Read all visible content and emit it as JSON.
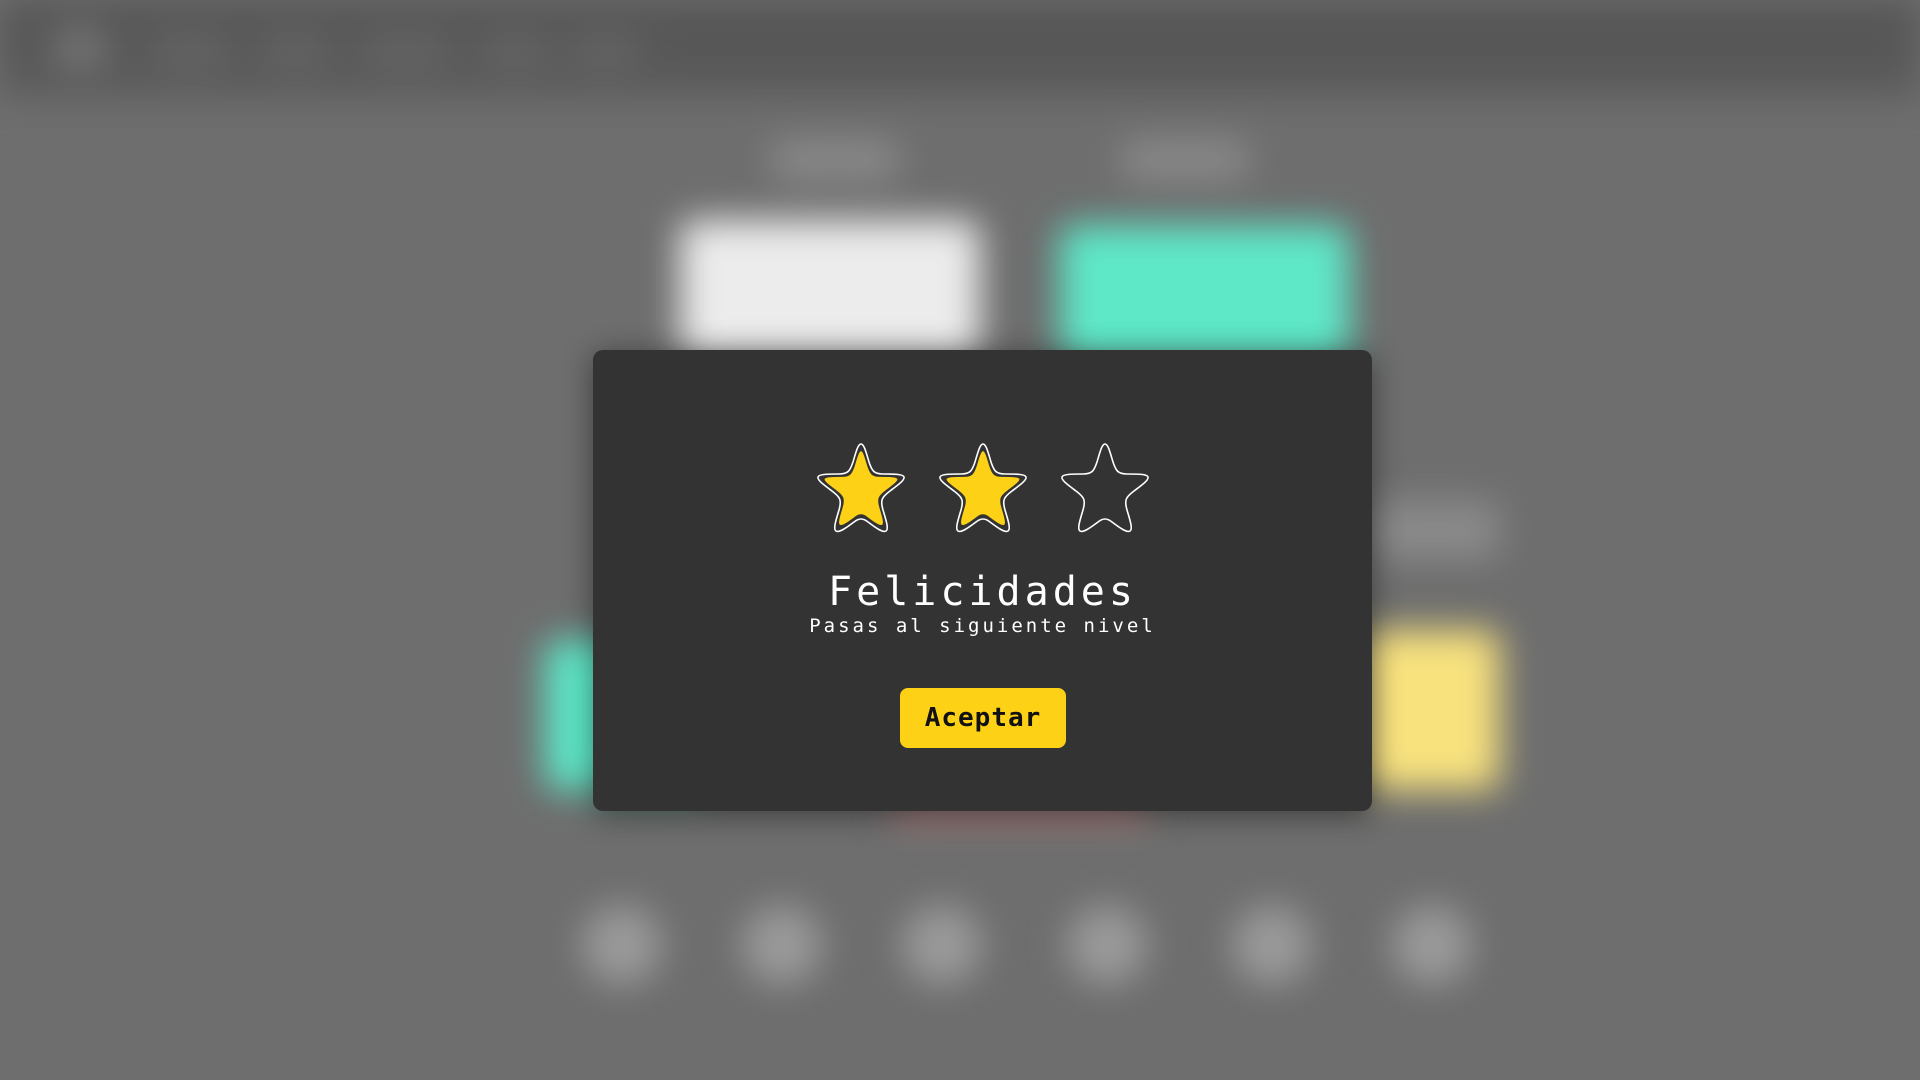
{
  "modal": {
    "rating": {
      "earned": 2,
      "total": 3
    },
    "title": "Felicidades",
    "subtitle": "Pasas al siguiente nivel",
    "accept_label": "Aceptar"
  },
  "colors": {
    "star_filled": "#fcd116",
    "button": "#fcd116",
    "modal_bg": "#333333",
    "background_overlay": "#6e6e6e",
    "bg_teal": "#5ee8c8",
    "bg_yellow": "#f8e27e",
    "bg_white": "#ececec"
  },
  "icons": {
    "star": "star-icon"
  }
}
